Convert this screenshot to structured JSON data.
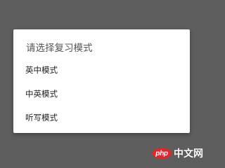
{
  "dialog": {
    "title": "请选择复习模式",
    "options": [
      {
        "label": "英中模式"
      },
      {
        "label": "中英模式"
      },
      {
        "label": "听写模式"
      }
    ]
  },
  "watermark": {
    "logo_text": "php",
    "site_text": "中文网"
  },
  "colors": {
    "overlay": "#5e5e5e",
    "dialog_background": "#ffffff",
    "title_text": "#555555",
    "option_text": "#222222",
    "watermark_accent": "#d42d2d"
  }
}
